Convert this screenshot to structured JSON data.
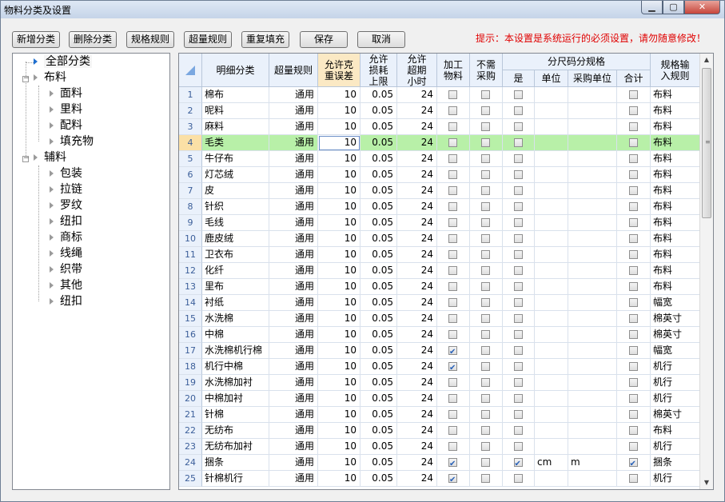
{
  "window": {
    "title": "物料分类及设置"
  },
  "toolbar": {
    "add_label": "新增分类",
    "delete_label": "删除分类",
    "spec_rule_label": "规格规则",
    "over_rule_label": "超量规则",
    "refill_label": "重复填充",
    "save_label": "保存",
    "cancel_label": "取消",
    "tip": "提示：本设置是系统运行的必须设置，请勿随意修改！"
  },
  "tree": {
    "root": "全部分类",
    "groups": [
      {
        "label": "布料",
        "children": [
          "面料",
          "里料",
          "配料",
          "填充物"
        ]
      },
      {
        "label": "辅料",
        "children": [
          "包装",
          "拉链",
          "罗纹",
          "纽扣",
          "商标",
          "线绳",
          "织带",
          "其他",
          "纽扣"
        ]
      }
    ]
  },
  "grid": {
    "headers": {
      "name": "明细分类",
      "over": "超量规则",
      "weight_err": "允许克重误差",
      "loss_limit": "允许损耗上限",
      "overdue": "允许超期小时",
      "process": "加工物料",
      "no_purchase": "不需采购",
      "size_group": "分尺码分规格",
      "size_yes": "是",
      "unit": "单位",
      "purchase_unit": "采购单位",
      "total": "合计",
      "input_rule": "规格输入规则"
    },
    "rows": [
      {
        "no": "1",
        "name": "棉布",
        "over": "通用",
        "weight": "10",
        "loss": "0.05",
        "hours": "24",
        "process": false,
        "nopurchase": false,
        "yes": false,
        "unit": "",
        "punit": "",
        "total": false,
        "rule": "布料"
      },
      {
        "no": "2",
        "name": "呢料",
        "over": "通用",
        "weight": "10",
        "loss": "0.05",
        "hours": "24",
        "process": false,
        "nopurchase": false,
        "yes": false,
        "unit": "",
        "punit": "",
        "total": false,
        "rule": "布料"
      },
      {
        "no": "3",
        "name": "麻料",
        "over": "通用",
        "weight": "10",
        "loss": "0.05",
        "hours": "24",
        "process": false,
        "nopurchase": false,
        "yes": false,
        "unit": "",
        "punit": "",
        "total": false,
        "rule": "布料"
      },
      {
        "no": "4",
        "name": "毛类",
        "over": "通用",
        "weight": "10",
        "loss": "0.05",
        "hours": "24",
        "process": false,
        "nopurchase": false,
        "yes": false,
        "unit": "",
        "punit": "",
        "total": false,
        "rule": "布料",
        "selected": true
      },
      {
        "no": "5",
        "name": "牛仔布",
        "over": "通用",
        "weight": "10",
        "loss": "0.05",
        "hours": "24",
        "process": false,
        "nopurchase": false,
        "yes": false,
        "unit": "",
        "punit": "",
        "total": false,
        "rule": "布料"
      },
      {
        "no": "6",
        "name": "灯芯绒",
        "over": "通用",
        "weight": "10",
        "loss": "0.05",
        "hours": "24",
        "process": false,
        "nopurchase": false,
        "yes": false,
        "unit": "",
        "punit": "",
        "total": false,
        "rule": "布料"
      },
      {
        "no": "7",
        "name": "皮",
        "over": "通用",
        "weight": "10",
        "loss": "0.05",
        "hours": "24",
        "process": false,
        "nopurchase": false,
        "yes": false,
        "unit": "",
        "punit": "",
        "total": false,
        "rule": "布料"
      },
      {
        "no": "8",
        "name": "针织",
        "over": "通用",
        "weight": "10",
        "loss": "0.05",
        "hours": "24",
        "process": false,
        "nopurchase": false,
        "yes": false,
        "unit": "",
        "punit": "",
        "total": false,
        "rule": "布料"
      },
      {
        "no": "9",
        "name": "毛线",
        "over": "通用",
        "weight": "10",
        "loss": "0.05",
        "hours": "24",
        "process": false,
        "nopurchase": false,
        "yes": false,
        "unit": "",
        "punit": "",
        "total": false,
        "rule": "布料"
      },
      {
        "no": "10",
        "name": "鹿皮绒",
        "over": "通用",
        "weight": "10",
        "loss": "0.05",
        "hours": "24",
        "process": false,
        "nopurchase": false,
        "yes": false,
        "unit": "",
        "punit": "",
        "total": false,
        "rule": "布料"
      },
      {
        "no": "11",
        "name": "卫衣布",
        "over": "通用",
        "weight": "10",
        "loss": "0.05",
        "hours": "24",
        "process": false,
        "nopurchase": false,
        "yes": false,
        "unit": "",
        "punit": "",
        "total": false,
        "rule": "布料"
      },
      {
        "no": "12",
        "name": "化纤",
        "over": "通用",
        "weight": "10",
        "loss": "0.05",
        "hours": "24",
        "process": false,
        "nopurchase": false,
        "yes": false,
        "unit": "",
        "punit": "",
        "total": false,
        "rule": "布料"
      },
      {
        "no": "13",
        "name": "里布",
        "over": "通用",
        "weight": "10",
        "loss": "0.05",
        "hours": "24",
        "process": false,
        "nopurchase": false,
        "yes": false,
        "unit": "",
        "punit": "",
        "total": false,
        "rule": "布料"
      },
      {
        "no": "14",
        "name": "衬纸",
        "over": "通用",
        "weight": "10",
        "loss": "0.05",
        "hours": "24",
        "process": false,
        "nopurchase": false,
        "yes": false,
        "unit": "",
        "punit": "",
        "total": false,
        "rule": "幅宽"
      },
      {
        "no": "15",
        "name": "水洗棉",
        "over": "通用",
        "weight": "10",
        "loss": "0.05",
        "hours": "24",
        "process": false,
        "nopurchase": false,
        "yes": false,
        "unit": "",
        "punit": "",
        "total": false,
        "rule": "棉英寸"
      },
      {
        "no": "16",
        "name": "中棉",
        "over": "通用",
        "weight": "10",
        "loss": "0.05",
        "hours": "24",
        "process": false,
        "nopurchase": false,
        "yes": false,
        "unit": "",
        "punit": "",
        "total": false,
        "rule": "棉英寸"
      },
      {
        "no": "17",
        "name": "水洗棉机行棉",
        "over": "通用",
        "weight": "10",
        "loss": "0.05",
        "hours": "24",
        "process": true,
        "nopurchase": false,
        "yes": false,
        "unit": "",
        "punit": "",
        "total": false,
        "rule": "幅宽"
      },
      {
        "no": "18",
        "name": "机行中棉",
        "over": "通用",
        "weight": "10",
        "loss": "0.05",
        "hours": "24",
        "process": true,
        "nopurchase": false,
        "yes": false,
        "unit": "",
        "punit": "",
        "total": false,
        "rule": "机行"
      },
      {
        "no": "19",
        "name": "水洗棉加衬",
        "over": "通用",
        "weight": "10",
        "loss": "0.05",
        "hours": "24",
        "process": false,
        "nopurchase": false,
        "yes": false,
        "unit": "",
        "punit": "",
        "total": false,
        "rule": "机行"
      },
      {
        "no": "20",
        "name": "中棉加衬",
        "over": "通用",
        "weight": "10",
        "loss": "0.05",
        "hours": "24",
        "process": false,
        "nopurchase": false,
        "yes": false,
        "unit": "",
        "punit": "",
        "total": false,
        "rule": "机行"
      },
      {
        "no": "21",
        "name": "针棉",
        "over": "通用",
        "weight": "10",
        "loss": "0.05",
        "hours": "24",
        "process": false,
        "nopurchase": false,
        "yes": false,
        "unit": "",
        "punit": "",
        "total": false,
        "rule": "棉英寸"
      },
      {
        "no": "22",
        "name": "无纺布",
        "over": "通用",
        "weight": "10",
        "loss": "0.05",
        "hours": "24",
        "process": false,
        "nopurchase": false,
        "yes": false,
        "unit": "",
        "punit": "",
        "total": false,
        "rule": "布料"
      },
      {
        "no": "23",
        "name": "无纺布加衬",
        "over": "通用",
        "weight": "10",
        "loss": "0.05",
        "hours": "24",
        "process": false,
        "nopurchase": false,
        "yes": false,
        "unit": "",
        "punit": "",
        "total": false,
        "rule": "机行"
      },
      {
        "no": "24",
        "name": "捆条",
        "over": "通用",
        "weight": "10",
        "loss": "0.05",
        "hours": "24",
        "process": true,
        "nopurchase": false,
        "yes": true,
        "unit": "cm",
        "punit": "m",
        "total": true,
        "rule": "捆条"
      },
      {
        "no": "25",
        "name": "针棉机行",
        "over": "通用",
        "weight": "10",
        "loss": "0.05",
        "hours": "24",
        "process": true,
        "nopurchase": false,
        "yes": false,
        "unit": "",
        "punit": "",
        "total": false,
        "rule": "机行"
      }
    ]
  }
}
